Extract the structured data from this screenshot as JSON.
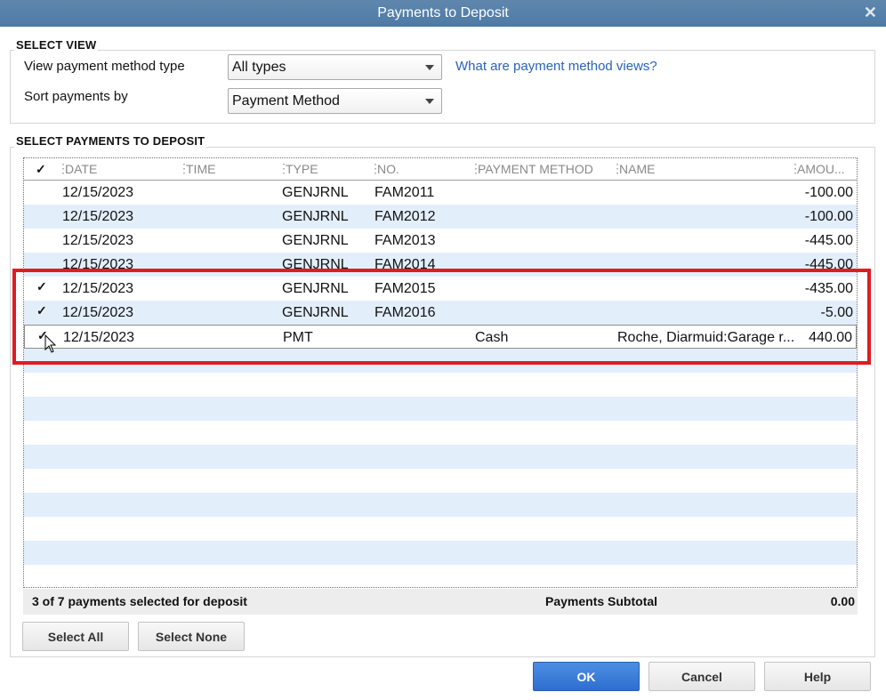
{
  "window": {
    "title": "Payments to Deposit",
    "close_glyph": "✕"
  },
  "select_view": {
    "section_label": "SELECT VIEW",
    "view_label": "View payment method type",
    "view_value": "All types",
    "sort_label": "Sort payments by",
    "sort_value": "Payment Method",
    "help_link": "What are payment method views?"
  },
  "payments": {
    "section_label": "SELECT PAYMENTS TO DEPOSIT",
    "columns": {
      "check": "✓",
      "date": "DATE",
      "time": "TIME",
      "type": "TYPE",
      "no": "NO.",
      "payment_method": "PAYMENT METHOD",
      "name": "NAME",
      "amount": "AMOU..."
    },
    "rows": [
      {
        "checked": "",
        "date": "12/15/2023",
        "time": "",
        "type": "GENJRNL",
        "no": "FAM2011",
        "payment_method": "",
        "name": "",
        "amount": "-100.00"
      },
      {
        "checked": "",
        "date": "12/15/2023",
        "time": "",
        "type": "GENJRNL",
        "no": "FAM2012",
        "payment_method": "",
        "name": "",
        "amount": "-100.00"
      },
      {
        "checked": "",
        "date": "12/15/2023",
        "time": "",
        "type": "GENJRNL",
        "no": "FAM2013",
        "payment_method": "",
        "name": "",
        "amount": "-445.00"
      },
      {
        "checked": "",
        "date": "12/15/2023",
        "time": "",
        "type": "GENJRNL",
        "no": "FAM2014",
        "payment_method": "",
        "name": "",
        "amount": "-445.00"
      },
      {
        "checked": "✓",
        "date": "12/15/2023",
        "time": "",
        "type": "GENJRNL",
        "no": "FAM2015",
        "payment_method": "",
        "name": "",
        "amount": "-435.00"
      },
      {
        "checked": "✓",
        "date": "12/15/2023",
        "time": "",
        "type": "GENJRNL",
        "no": "FAM2016",
        "payment_method": "",
        "name": "",
        "amount": "-5.00"
      },
      {
        "checked": "✓",
        "date": "12/15/2023",
        "time": "",
        "type": "PMT",
        "no": "",
        "payment_method": "Cash",
        "name": "Roche, Diarmuid:Garage r...",
        "amount": "440.00"
      }
    ],
    "selected_summary": "3 of 7 payments selected for deposit",
    "subtotal_label": "Payments Subtotal",
    "subtotal_value": "0.00"
  },
  "buttons": {
    "select_all": "Select All",
    "select_none": "Select None",
    "ok": "OK",
    "cancel": "Cancel",
    "help": "Help"
  },
  "colors": {
    "title_bar": "#5582ab",
    "alt_row": "#e3eefb",
    "highlight_box": "#e01b24",
    "ok_button": "#2d6fd0",
    "link": "#2b63b7"
  }
}
